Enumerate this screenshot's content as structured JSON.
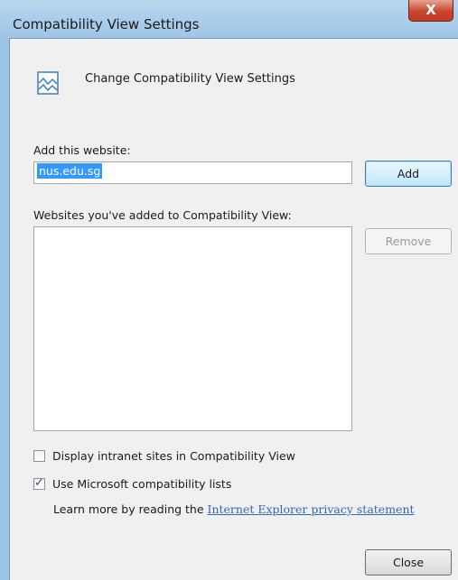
{
  "window": {
    "title": "Compatibility View Settings",
    "close_glyph": "X"
  },
  "header": {
    "icon": "compatibility-view-icon",
    "text": "Change Compatibility View Settings"
  },
  "add_section": {
    "label": "Add this website:",
    "input_value": "nus.edu.sg",
    "add_button": "Add"
  },
  "list_section": {
    "label": "Websites you've added to Compatibility View:",
    "items": [],
    "remove_button": "Remove"
  },
  "options": {
    "intranet": {
      "label": "Display intranet sites in Compatibility View",
      "checked": false
    },
    "ms_lists": {
      "label": "Use Microsoft compatibility lists",
      "checked": true
    }
  },
  "learn_more": {
    "prefix": "Learn more by reading the ",
    "link": "Internet Explorer privacy statement"
  },
  "footer": {
    "close_button": "Close"
  },
  "colors": {
    "titlebar": "#9ec5e7",
    "close_button": "#c8462f",
    "selection": "#3399ff",
    "link": "#2f69b8"
  }
}
